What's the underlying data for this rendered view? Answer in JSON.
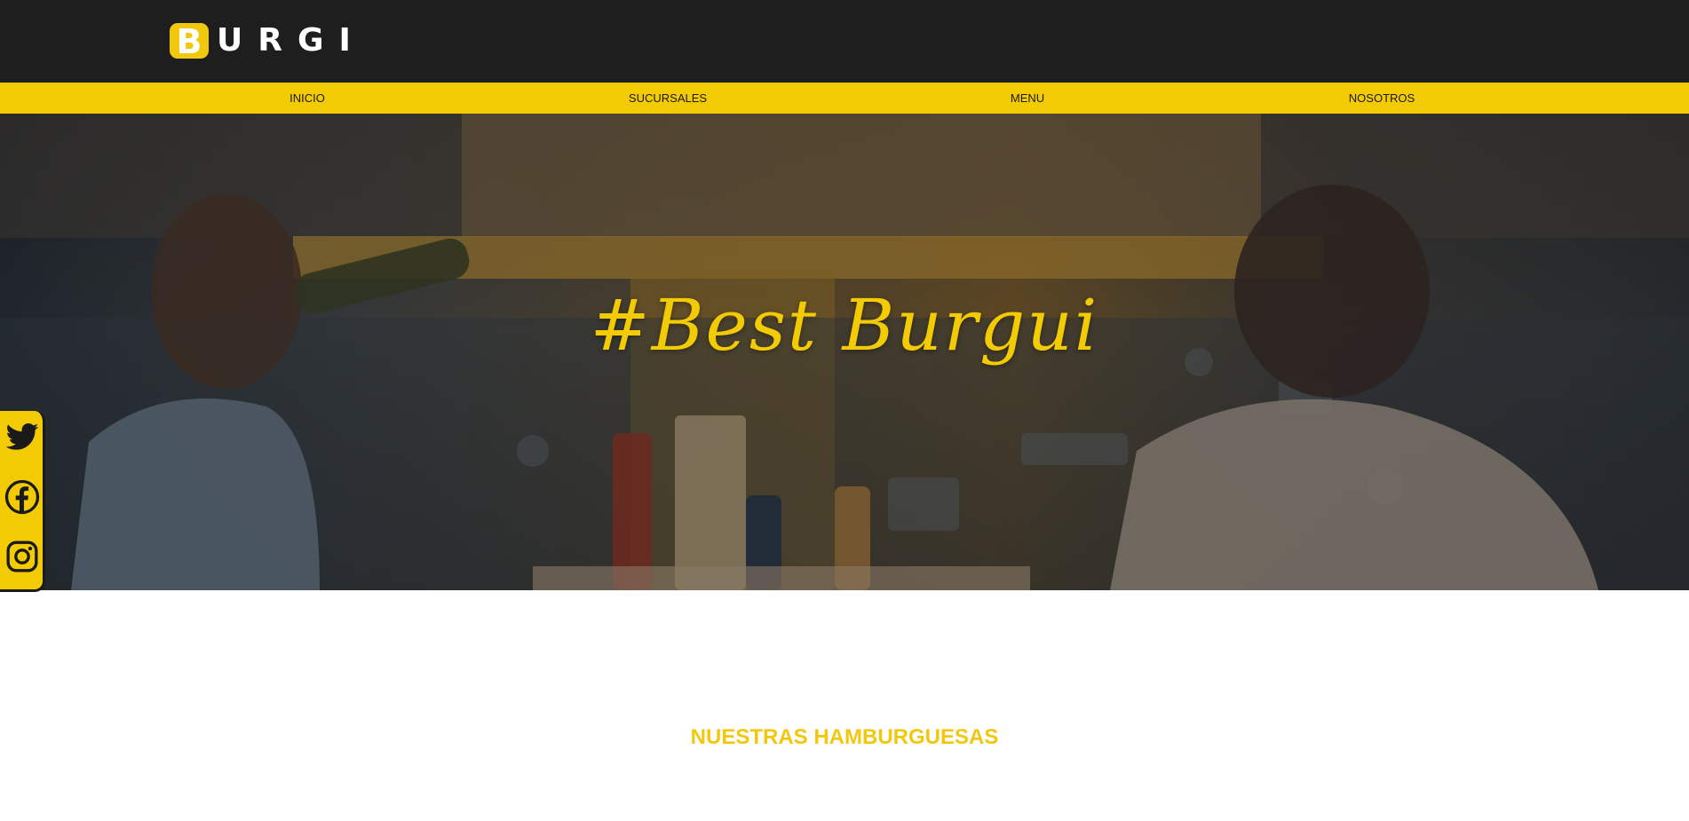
{
  "brand": {
    "logo_initial": "B",
    "logo_rest": "URGI",
    "accent_color": "#f2cb05",
    "header_color": "#1e1e1e"
  },
  "nav": {
    "items": [
      {
        "label": "INICIO"
      },
      {
        "label": "SUCURSALES"
      },
      {
        "label": "MENU"
      },
      {
        "label": "NOSOTROS"
      }
    ]
  },
  "hero": {
    "title": "#Best Burgui",
    "image": "photo-two-young-men-in-burger-restaurant"
  },
  "social": {
    "items": [
      {
        "icon": "twitter-icon"
      },
      {
        "icon": "facebook-icon"
      },
      {
        "icon": "instagram-icon"
      }
    ]
  },
  "section": {
    "title": "NUESTRAS HAMBURGUESAS"
  }
}
